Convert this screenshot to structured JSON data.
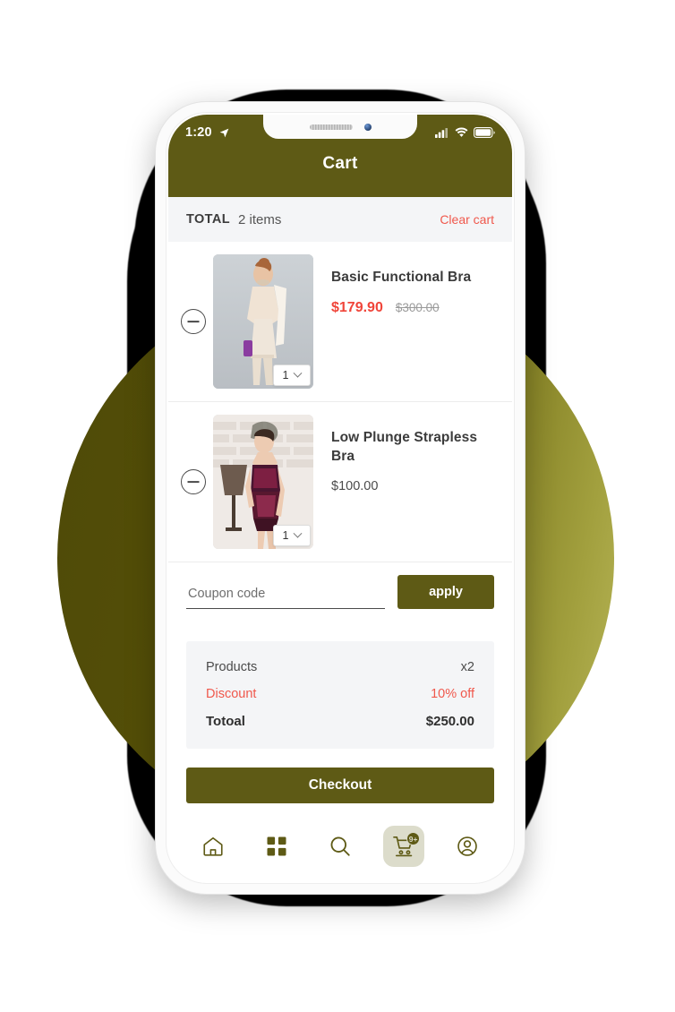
{
  "theme": {
    "olive": "#5e5a15",
    "accent_red": "#f0584c",
    "panel_gray": "#f4f5f7",
    "circle_dark": "#4f4a08",
    "circle_light": "#b9b75a"
  },
  "status_bar": {
    "time": "1:20",
    "location_icon": "location-arrow-icon",
    "signal_icon": "cellular-signal-icon",
    "wifi_icon": "wifi-icon",
    "battery_icon": "battery-full-icon"
  },
  "header": {
    "title": "Cart"
  },
  "total_bar": {
    "label": "TOTAL",
    "items_count": "2 items",
    "clear_label": "Clear cart"
  },
  "items": [
    {
      "name": "Basic Functional Bra",
      "price": "$179.90",
      "old_price": "$300.00",
      "qty": "1",
      "remove_icon": "minus-circle-icon",
      "image_alt": "woman-in-cream-bra-and-shorts"
    },
    {
      "name": "Low Plunge Strapless Bra",
      "price": "$100.00",
      "old_price": "",
      "qty": "1",
      "remove_icon": "minus-circle-icon",
      "image_alt": "woman-in-burgundy-lace-bodysuit"
    }
  ],
  "coupon": {
    "placeholder": "Coupon code",
    "value": "",
    "apply_label": "apply"
  },
  "summary": {
    "rows": [
      {
        "key": "Products",
        "value": "x2",
        "style": "normal"
      },
      {
        "key": "Discount",
        "value": "10% off",
        "style": "discount"
      },
      {
        "key": "Totoal",
        "value": "$250.00",
        "style": "total"
      }
    ]
  },
  "checkout": {
    "label": "Checkout"
  },
  "bottom_nav": {
    "items": [
      {
        "name": "home-icon",
        "active": false,
        "badge": ""
      },
      {
        "name": "grid-icon",
        "active": false,
        "badge": ""
      },
      {
        "name": "search-icon",
        "active": false,
        "badge": ""
      },
      {
        "name": "cart-icon",
        "active": true,
        "badge": "9+"
      },
      {
        "name": "profile-icon",
        "active": false,
        "badge": ""
      }
    ]
  }
}
